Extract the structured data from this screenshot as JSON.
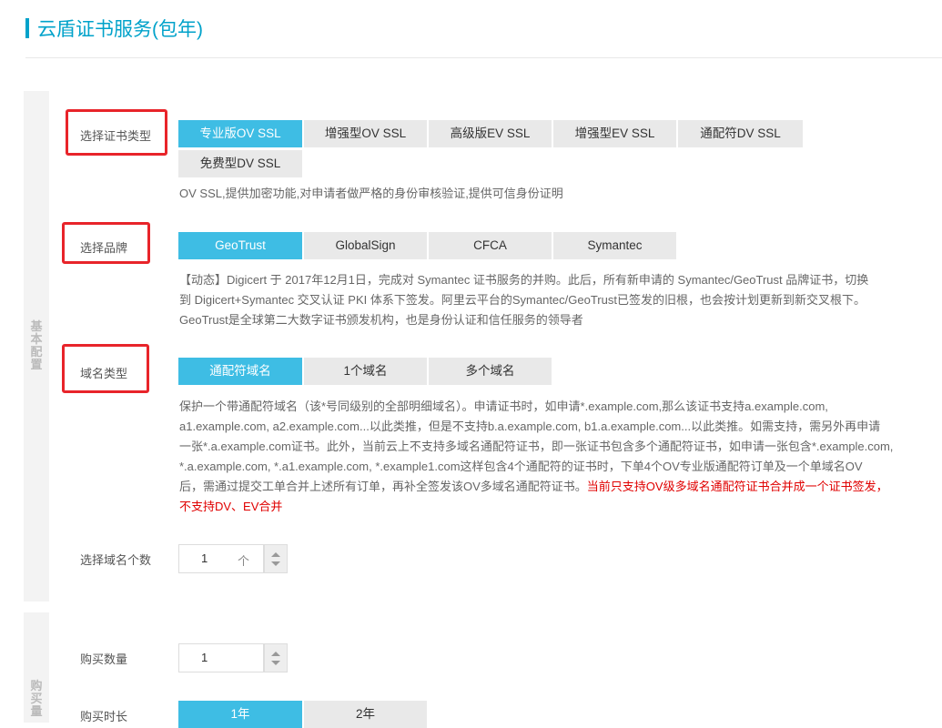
{
  "page": {
    "title": "云盾证书服务(包年)"
  },
  "basic": {
    "side_label": "基本配置",
    "cert_type": {
      "label": "选择证书类型",
      "options": [
        "专业版OV SSL",
        "增强型OV SSL",
        "高级版EV SSL",
        "增强型EV SSL",
        "通配符DV SSL",
        "免费型DV SSL"
      ],
      "selected": "专业版OV SSL",
      "desc": "OV SSL,提供加密功能,对申请者做严格的身份审核验证,提供可信身份证明"
    },
    "brand": {
      "label": "选择品牌",
      "options": [
        "GeoTrust",
        "GlobalSign",
        "CFCA",
        "Symantec"
      ],
      "selected": "GeoTrust",
      "desc_lines": [
        "【动态】Digicert 于 2017年12月1日，完成对 Symantec 证书服务的并购。此后，所有新申请的 Symantec/GeoTrust 品牌证书，切换",
        "到 Digicert+Symantec 交叉认证 PKI 体系下签发。阿里云平台的Symantec/GeoTrust已签发的旧根，也会按计划更新到新交叉根下。",
        "GeoTrust是全球第二大数字证书颁发机构，也是身份认证和信任服务的领导者"
      ]
    },
    "domain_type": {
      "label": "域名类型",
      "options": [
        "通配符域名",
        "1个域名",
        "多个域名"
      ],
      "selected": "通配符域名",
      "desc_lines": [
        "保护一个带通配符域名（该*号同级别的全部明细域名）。申请证书时，如申请*.example.com,那么该证书支持a.example.com,",
        "a1.example.com, a2.example.com...以此类推，但是不支持b.a.example.com, b1.a.example.com...以此类推。如需支持，需另外再申请",
        "一张*.a.example.com证书。此外，当前云上不支持多域名通配符证书，即一张证书包含多个通配符证书，如申请一张包含*.example.com,",
        "*.a.example.com, *.a1.example.com, *.example1.com这样包含4个通配符的证书时，下单4个OV专业版通配符订单及一个单域名OV",
        "后，需通过提交工单合并上述所有订单，再补全签发该OV多域名通配符证书。"
      ],
      "warn_part1": "当前只支持OV级多域名通配符证书合并成一个证书签发，",
      "warn_part2": "不支持DV、EV合并"
    },
    "domain_count": {
      "label": "选择域名个数",
      "value": "1",
      "unit": "个"
    }
  },
  "purchase": {
    "side_label": "购买量",
    "quantity": {
      "label": "购买数量",
      "value": "1"
    },
    "duration": {
      "label": "购买时长",
      "options": [
        "1年",
        "2年"
      ],
      "selected": "1年"
    }
  },
  "colors": {
    "accent": "#00a2ca",
    "selected": "#3ebde4",
    "highlight_box": "#e8242a",
    "warning_text": "#e00000"
  }
}
